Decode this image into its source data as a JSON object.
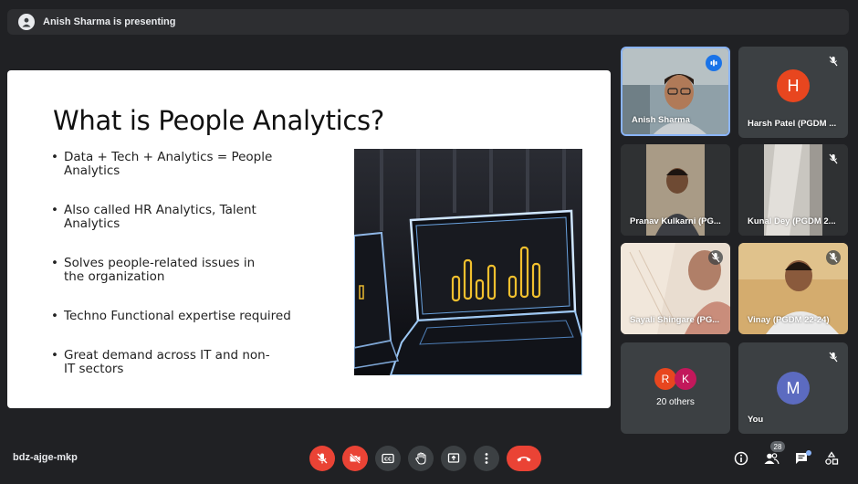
{
  "banner": {
    "presenter_text": "Anish Sharma is presenting"
  },
  "slide": {
    "title": "What is People Analytics?",
    "bullets": [
      "Data + Tech + Analytics = People Analytics",
      "Also called HR Analytics, Talent Analytics",
      "Solves people-related issues in the organization",
      "Techno Functional expertise required",
      "Great demand across IT and non-IT sectors"
    ]
  },
  "participants": [
    {
      "name": "Anish Sharma"
    },
    {
      "name": "Harsh Patel (PGDM ...",
      "initial": "H",
      "color": "#e8461f"
    },
    {
      "name": "Pranav Kulkarni (PG..."
    },
    {
      "name": "Kunal Dey (PGDM 2..."
    },
    {
      "name": "Sayali Shingare (PG..."
    },
    {
      "name": "Vinay (PGDM 22-24)"
    },
    {
      "label": "20 others",
      "initials": [
        "R",
        "K"
      ],
      "colors": [
        "#e8461f",
        "#c2185b"
      ]
    },
    {
      "name": "You",
      "initial": "M",
      "color": "#5c6bc0"
    }
  ],
  "meeting": {
    "code": "bdz-ajge-mkp",
    "people_count": "28"
  },
  "colors": {
    "hangup": "#ea4335",
    "active_border": "#8ab4f8",
    "speaking": "#1a73e8"
  }
}
